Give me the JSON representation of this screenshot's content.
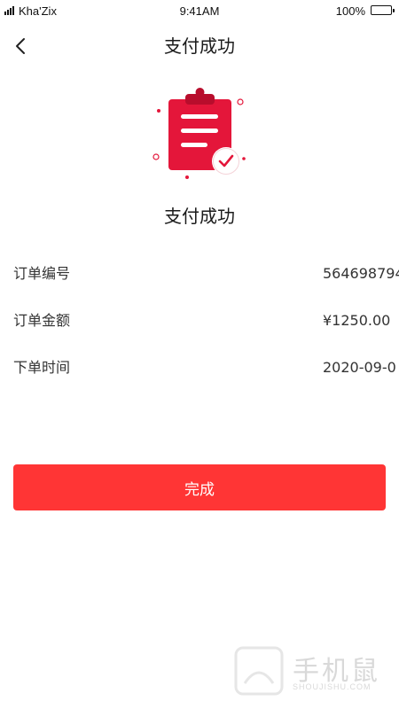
{
  "status_bar": {
    "carrier": "Kha'Zix",
    "time": "9:41AM",
    "battery": "100%"
  },
  "nav": {
    "title": "支付成功",
    "back_icon": "chevron-left-icon"
  },
  "result": {
    "title": "支付成功",
    "icon": "clipboard-check-icon",
    "accent_color": "#e4163a"
  },
  "order": {
    "rows": [
      {
        "label": "订单编号",
        "value": "564698794"
      },
      {
        "label": "订单金额",
        "value": "¥1250.00"
      },
      {
        "label": "下单时间",
        "value": "2020-09-0"
      }
    ]
  },
  "actions": {
    "done_label": "完成",
    "button_color": "#ff3535"
  },
  "watermark": {
    "text": "手机鼠",
    "sub": "SHOUJISHU.COM"
  }
}
